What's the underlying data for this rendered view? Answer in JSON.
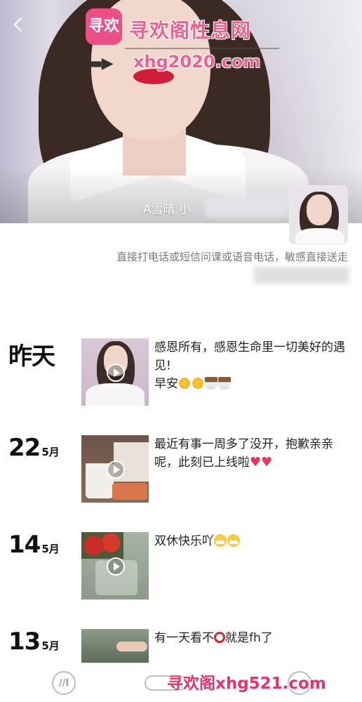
{
  "profile": {
    "name": "A雪晴 小",
    "signature": "直接打电话或短信问课或语音电话，敏感直接送走"
  },
  "watermark": {
    "logo_text": "寻欢",
    "title": "寻欢阁性息网",
    "arrow": "▬▶",
    "url": "xhg2020.com",
    "bottom": "寻欢阁xhg521.com"
  },
  "feed": [
    {
      "day": "昨天",
      "month": "",
      "text": "感恩所有，感恩生命里一切美好的遇见!",
      "text2": "早安",
      "emoji": [
        "sun",
        "sun",
        "coffee",
        "coffee"
      ]
    },
    {
      "day": "22",
      "month": "5月",
      "text": "最近有事一周多了没开，抱歉亲亲呢，此刻已上线啦",
      "emoji": [
        "heart",
        "heart"
      ]
    },
    {
      "day": "14",
      "month": "5月",
      "text": "双休快乐吖",
      "emoji": [
        "grin",
        "grin"
      ]
    },
    {
      "day": "13",
      "month": "5月",
      "text_a": "有一天看不",
      "text_b": "就是fh了"
    }
  ],
  "bottom_nav": {
    "left_label": "//I"
  },
  "colors": {
    "accent": "#f0608f",
    "heart": "#e9345f",
    "text": "#222222",
    "secondary_text": "#777777"
  }
}
